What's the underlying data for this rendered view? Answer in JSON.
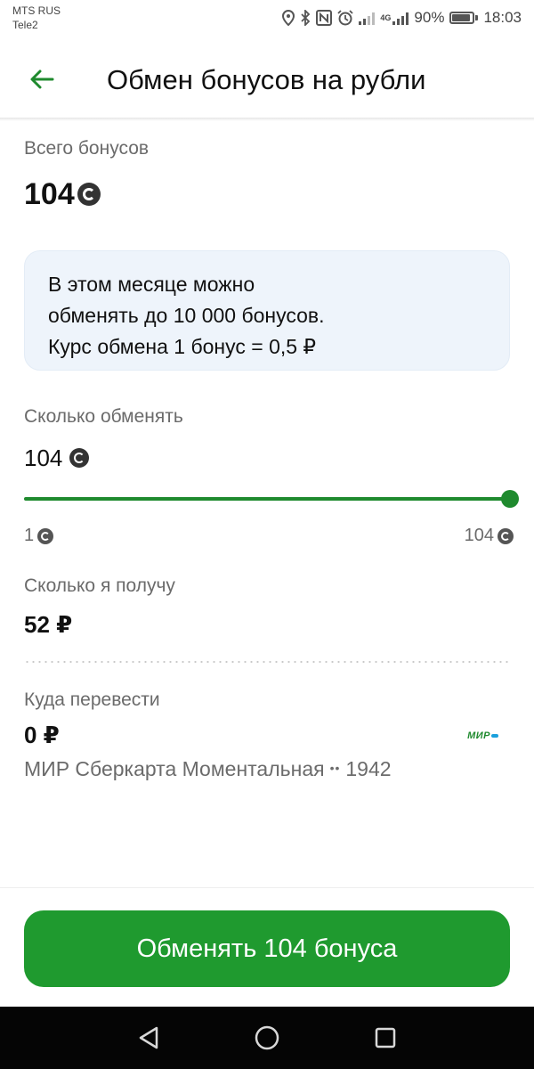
{
  "status_bar": {
    "carrier_1": "MTS RUS",
    "carrier_2": "Tele2",
    "network_tag": "4G",
    "battery": "90%",
    "time": "18:03"
  },
  "header": {
    "title": "Обмен бонусов на рубли",
    "back_icon": "arrow-left-icon"
  },
  "total": {
    "label": "Всего бонусов",
    "value": "104",
    "icon": "bonus-coin-icon"
  },
  "info": {
    "line1": "В этом месяце можно",
    "line2": "обменять до 10 000 бонусов.",
    "line3": "Курс обмена 1 бонус = 0,5 ₽"
  },
  "exchange": {
    "label": "Сколько обменять",
    "value": "104",
    "slider_min": "1",
    "slider_max": "104",
    "slider_fraction": 1.0
  },
  "receive": {
    "label": "Сколько я получу",
    "value": "52 ₽"
  },
  "transfer": {
    "label": "Куда перевести",
    "balance": "0 ₽",
    "card_name": "МИР Сберкарта Моментальная",
    "card_dots": "••",
    "card_last4": "1942",
    "card_logo": "МИР"
  },
  "cta": {
    "label": "Обменять 104 бонуса"
  },
  "colors": {
    "accent": "#1f9a2f",
    "slider": "#1f8a2e",
    "info_bg": "#eef4fb"
  },
  "nav": {
    "back_icon": "nav-back-triangle-icon",
    "home_icon": "nav-home-circle-icon",
    "recents_icon": "nav-recents-square-icon"
  }
}
